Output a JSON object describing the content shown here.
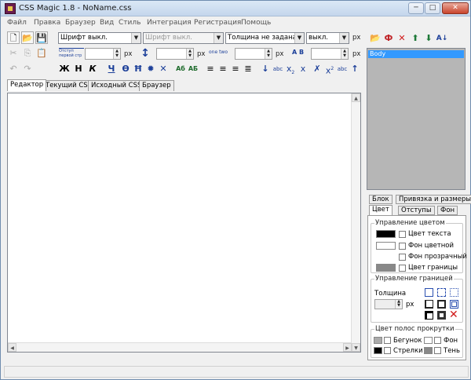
{
  "window": {
    "title": "CSS Magic 1.8 - NoName.css",
    "controls": {
      "minimize": "─",
      "maximize": "□",
      "close": "✕"
    }
  },
  "menu": [
    "Файл",
    "Правка",
    "Браузер",
    "Вид",
    "Стиль",
    "Интеграция",
    "Регистрация",
    "Помощь"
  ],
  "toolbar": {
    "font_combo": "Шрифт выкл.",
    "font2_combo": "Шрифт выкл.",
    "weight_combo": "Толщина не задана",
    "size_combo": "выкл.",
    "unit_px": "px",
    "indent_label": "Отступ первой стр",
    "line_label": "one two",
    "ab_label": "A B",
    "bold": "Ж",
    "h": "H",
    "italic": "К",
    "underline": "Ч",
    "strike": "Ө",
    "overline": "Ħ",
    "ab1": "Аб",
    "ab2": "АБ",
    "abc": "abc",
    "x2": "x",
    "x2sup": "2",
    "x2sub": "2"
  },
  "tabs": [
    "Редактор",
    "Текущий CSS",
    "Исходный CSS",
    "Браузер"
  ],
  "editor": {
    "content": ""
  },
  "selector_list": [
    "Body"
  ],
  "panel_tabs_row1": [
    "Блок",
    "Привязка и размеры"
  ],
  "panel_tabs_row2": [
    "Цвет",
    "Отступы",
    "Фон"
  ],
  "color_group": {
    "title": "Управление цветом",
    "items": [
      "Цвет текста",
      "Фон цветной",
      "Фон прозрачный",
      "Цвет границы"
    ],
    "swatches": [
      "#000000",
      "#ffffff",
      "#888888"
    ]
  },
  "border_group": {
    "title": "Управление границей",
    "thickness_label": "Толщина",
    "unit": "px"
  },
  "scroll_group": {
    "title": "Цвет полос прокрутки",
    "items": [
      "Бегунок",
      "Фон",
      "Стрелки",
      "Тень"
    ]
  },
  "colors": {
    "accent": "#3399ff",
    "panel_gray": "#b6b6b6",
    "brand": "#6a1d4f"
  }
}
